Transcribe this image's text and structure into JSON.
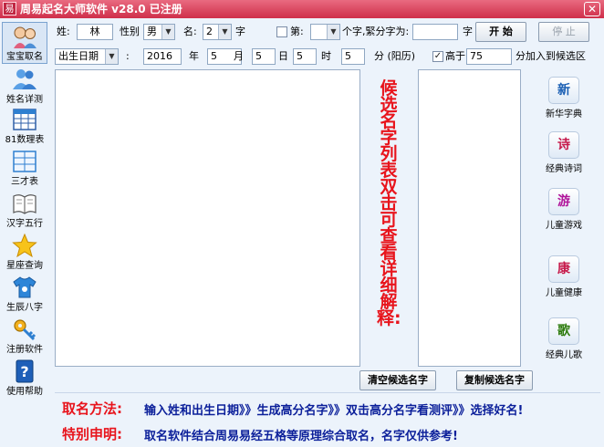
{
  "window": {
    "title": "周易起名大师软件 v28.0 已注册",
    "icon_glyph": "易",
    "close_glyph": "✕"
  },
  "sidebar": {
    "items": [
      {
        "label": "宝宝取名",
        "icon": "baby-icon"
      },
      {
        "label": "姓名详测",
        "icon": "people-icon"
      },
      {
        "label": "81数理表",
        "icon": "grid-table-icon"
      },
      {
        "label": "三才表",
        "icon": "table-icon"
      },
      {
        "label": "汉字五行",
        "icon": "book-icon"
      },
      {
        "label": "星座查询",
        "icon": "star-icon"
      },
      {
        "label": "生辰八字",
        "icon": "shirt-icon"
      },
      {
        "label": "注册软件",
        "icon": "key-icon"
      },
      {
        "label": "使用帮助",
        "icon": "help-icon"
      }
    ]
  },
  "form": {
    "surname_label": "姓:",
    "surname_value": "林",
    "gender_label": "性别",
    "gender_value": "男",
    "name_label": "名:",
    "name_count_value": "2",
    "name_unit": "字",
    "position_label": "第:",
    "position_value": "",
    "fixed_label": "个字,緊分字为:",
    "fixed_value": "",
    "fixed_unit": "字",
    "start_label": "开 始",
    "stop_label": "停 止",
    "date_type_value": "出生日期",
    "colon": ":",
    "year_value": "2016",
    "year_unit": "年",
    "month_value": "5",
    "month_unit": "月",
    "day_value": "5",
    "day_unit": "日",
    "hour_value": "5",
    "hour_unit": "时",
    "minute_value": "5",
    "minute_unit": "分 (阳历)",
    "above_checked": "✓",
    "above_label": "高于",
    "score_value": "75",
    "add_label": "分加入到候选区"
  },
  "hint": "候选名字列表双击可查看详细解释:",
  "buttons": {
    "clear_candidates": "清空候选名字",
    "copy_candidates": "复制候选名字"
  },
  "tools": [
    {
      "label": "新华字典",
      "glyph": "新",
      "color": "#1a5fb4"
    },
    {
      "label": "经典诗词",
      "glyph": "诗",
      "color": "#c61a4b"
    },
    {
      "label": "儿童游戏",
      "glyph": "游",
      "color": "#b0159a"
    },
    {
      "label": "儿童健康",
      "glyph": "康",
      "color": "#c61a4b"
    },
    {
      "label": "经典儿歌",
      "glyph": "歌",
      "color": "#2b7a0b"
    }
  ],
  "notes": {
    "method_title": "取名方法:",
    "method_text": "输入姓和出生日期》》生成高分名字》》双击高分名字看测评》》选择好名!",
    "notice_title": "特别申明:",
    "notice_text": "取名软件结合周易易经五格等原理综合取名，名字仅供参考!"
  }
}
